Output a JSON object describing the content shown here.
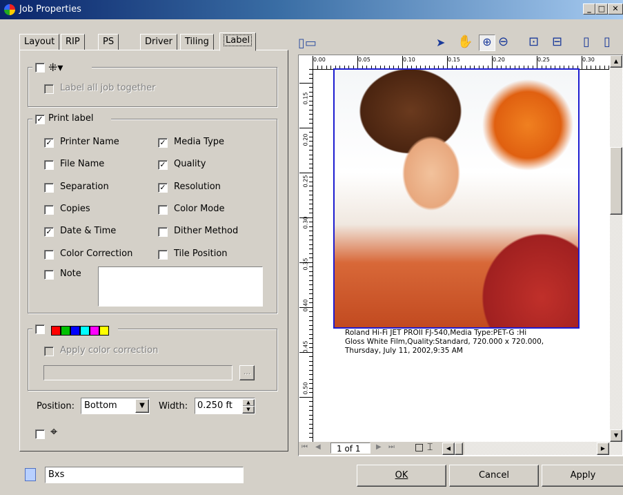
{
  "window": {
    "title": "Job Properties"
  },
  "tabs": [
    "Layout",
    "RIP",
    "PS",
    "Driver",
    "Tiling",
    "Label"
  ],
  "label_group": {
    "label_all_job": "Label all job together",
    "checked": false
  },
  "print_label": {
    "title": "Print label",
    "checked": true,
    "items": [
      {
        "label": "Printer Name",
        "checked": true
      },
      {
        "label": "Media Type",
        "checked": true
      },
      {
        "label": "File Name",
        "checked": false
      },
      {
        "label": "Quality",
        "checked": true
      },
      {
        "label": "Separation",
        "checked": false
      },
      {
        "label": "Resolution",
        "checked": true
      },
      {
        "label": "Copies",
        "checked": false
      },
      {
        "label": "Color Mode",
        "checked": false
      },
      {
        "label": "Date & Time",
        "checked": true
      },
      {
        "label": "Dither Method",
        "checked": false
      },
      {
        "label": "Color Correction",
        "checked": false
      },
      {
        "label": "Tile Position",
        "checked": false
      }
    ],
    "note_label": "Note",
    "note_value": ""
  },
  "color_group": {
    "checked": false,
    "swatch_colors": [
      "#ff0000",
      "#00c000",
      "#0000ff",
      "#00ffff",
      "#ff00ff",
      "#ffff00"
    ],
    "apply_label": "Apply color correction",
    "browse_label": "...",
    "path_value": ""
  },
  "position": {
    "label": "Position:",
    "value": "Bottom"
  },
  "width": {
    "label": "Width:",
    "value": "0.250 ft"
  },
  "crosshair_checked": false,
  "bottom": {
    "field_value": "Bxs",
    "ok": "OK",
    "cancel": "Cancel",
    "apply": "Apply"
  },
  "ruler": {
    "h_labels": [
      "0.00",
      "0.05",
      "0.10",
      "0.15",
      "0.20",
      "0.25",
      "0.30"
    ],
    "v_labels": [
      "0.15",
      "0.20",
      "0.25",
      "0.30",
      "0.35",
      "0.40",
      "0.45",
      "0.50"
    ]
  },
  "preview": {
    "caption_lines": [
      "Roland Hi-Fi JET PROII FJ-540,Media Type:PET-G :Hi",
      "Gloss White Film,Quality:Standard, 720.000 x 720.000,",
      "Thursday, July 11, 2002,9:35 AM"
    ],
    "page_indicator": "1 of 1"
  },
  "icons": [
    "app-icon",
    "layout-icon",
    "pointer-move-icon",
    "hand-icon",
    "zoom-in-icon",
    "zoom-out-icon",
    "zoom-fit-icon",
    "zoom-actual-icon",
    "page-portrait-icon",
    "page-landscape-icon",
    "document-icon"
  ]
}
